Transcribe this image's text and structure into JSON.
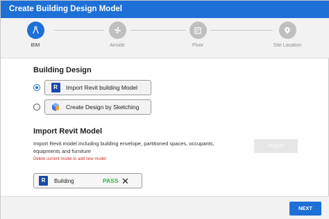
{
  "window": {
    "title": "Create Building Design Model"
  },
  "stepper": {
    "steps": [
      {
        "label": "BIM",
        "icon": "compass-icon",
        "active": true
      },
      {
        "label": "Airside",
        "icon": "fan-icon",
        "active": false
      },
      {
        "label": "Floor",
        "icon": "floor-icon",
        "active": false
      },
      {
        "label": "Site Location",
        "icon": "location-pin-icon",
        "active": false
      }
    ]
  },
  "building_design": {
    "title": "Building Design",
    "options": [
      {
        "label": "Import Revit building Model",
        "icon": "revit-icon",
        "selected": true
      },
      {
        "label": "Create Design by Sketching",
        "icon": "sketch-icon",
        "selected": false
      }
    ]
  },
  "import_revit": {
    "title": "Import Revit Model",
    "description": "Import Revit model including building envelope, partitioned spaces, occupants, equipments and furniture",
    "warning": "Delete current model to add new model",
    "import_label": "Import",
    "model": {
      "name": "Building",
      "status": "PASS",
      "revit_badge": "R"
    }
  },
  "footer": {
    "next_label": "NEXT"
  },
  "colors": {
    "accent": "#1e6fd6",
    "pass": "#2fb84a",
    "warning": "#d12a2a"
  }
}
